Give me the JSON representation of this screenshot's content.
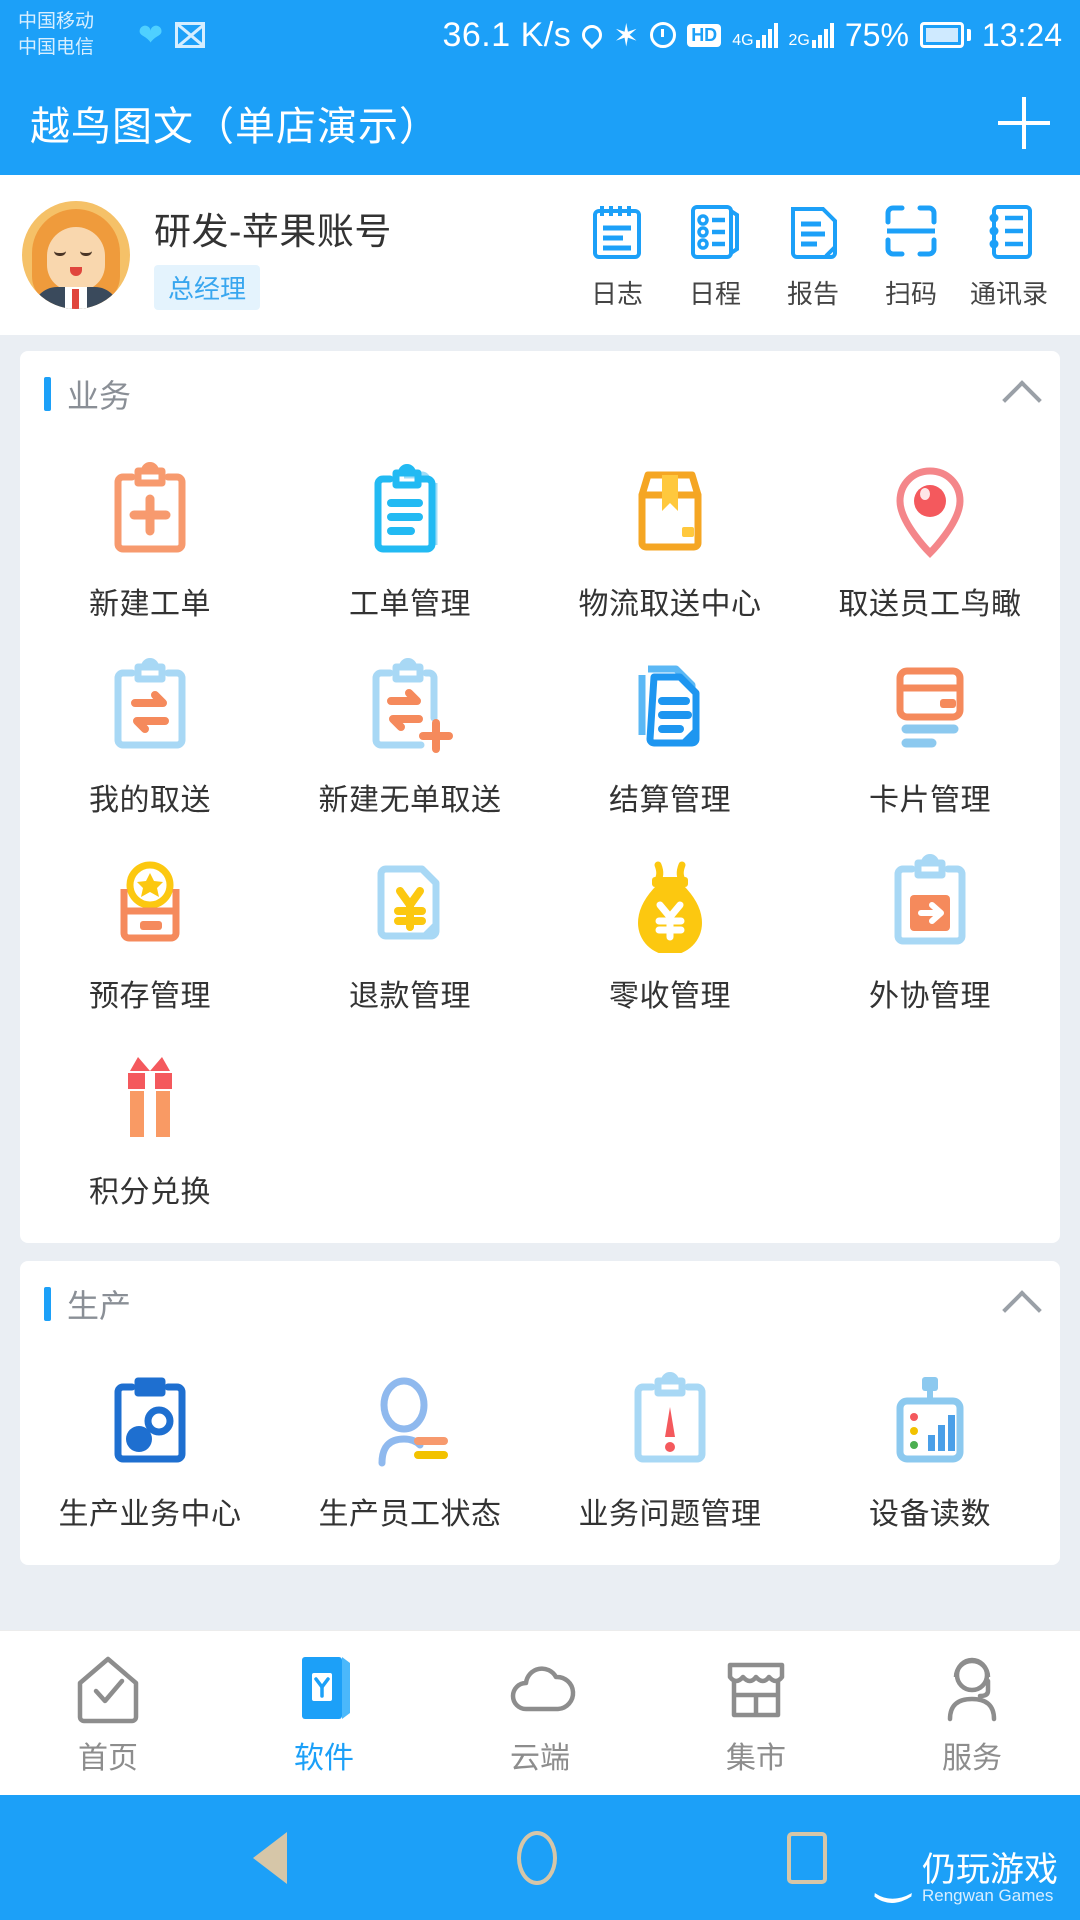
{
  "statusbar": {
    "carrier1": "中国移动",
    "carrier2": "中国电信",
    "net_speed": "36.1 K/s",
    "hd_badge": "HD",
    "sim1_gen": "4G",
    "sim2_gen": "2G",
    "battery_percent": "75%",
    "time": "13:24",
    "icons": [
      "heart-icon",
      "envelope-icon",
      "location-pin-icon",
      "bluetooth-icon",
      "alarm-clock-icon",
      "hd-icon",
      "signal-icon",
      "battery-icon"
    ]
  },
  "appbar": {
    "title": "越鸟图文（单店演示）",
    "add_label": "+"
  },
  "profile": {
    "name": "研发-苹果账号",
    "role_tag": "总经理",
    "quick_actions": [
      {
        "label": "日志",
        "icon": "notepad-icon"
      },
      {
        "label": "日程",
        "icon": "schedule-book-icon"
      },
      {
        "label": "报告",
        "icon": "report-document-icon"
      },
      {
        "label": "扫码",
        "icon": "scan-code-icon"
      },
      {
        "label": "通讯录",
        "icon": "contacts-book-icon"
      }
    ]
  },
  "sections": [
    {
      "title": "业务",
      "collapse_icon": "chevron-up-icon",
      "items": [
        {
          "label": "新建工单",
          "icon": "clipboard-plus-icon",
          "color": "#f79a6e"
        },
        {
          "label": "工单管理",
          "icon": "clipboard-list-icon",
          "color": "#22baf3"
        },
        {
          "label": "物流取送中心",
          "icon": "delivery-box-icon",
          "color": "#f5a623"
        },
        {
          "label": "取送员工鸟瞰",
          "icon": "map-pin-icon",
          "color": "#f4706e"
        },
        {
          "label": "我的取送",
          "icon": "clipboard-exchange-icon",
          "color": "#a8d8f5"
        },
        {
          "label": "新建无单取送",
          "icon": "clipboard-exchange-plus-icon",
          "color": "#a8d8f5"
        },
        {
          "label": "结算管理",
          "icon": "settlement-doc-icon",
          "color": "#1e96f0"
        },
        {
          "label": "卡片管理",
          "icon": "credit-card-icon",
          "color": "#f58a5c"
        },
        {
          "label": "预存管理",
          "icon": "prepaid-card-coin-icon",
          "color": "#f58a5c"
        },
        {
          "label": "退款管理",
          "icon": "refund-yuan-doc-icon",
          "color": "#a8d8f5"
        },
        {
          "label": "零收管理",
          "icon": "money-bag-icon",
          "color": "#fcc810"
        },
        {
          "label": "外协管理",
          "icon": "clipboard-arrow-right-icon",
          "color": "#a8d8f5"
        },
        {
          "label": "积分兑换",
          "icon": "gift-box-icon",
          "color": "#f99a64"
        }
      ]
    },
    {
      "title": "生产",
      "collapse_icon": "chevron-up-icon",
      "items": [
        {
          "label": "生产业务中心",
          "icon": "clipboard-gear-icon",
          "color": "#1e6fd0"
        },
        {
          "label": "生产员工状态",
          "icon": "worker-status-icon",
          "color": "#8fb9ee"
        },
        {
          "label": "业务问题管理",
          "icon": "clipboard-alert-icon",
          "color": "#a8d8f5"
        },
        {
          "label": "设备读数",
          "icon": "device-meter-icon",
          "color": "#a8d8f5"
        }
      ]
    }
  ],
  "tabbar": {
    "active_index": 1,
    "items": [
      {
        "label": "首页",
        "icon": "home-check-icon"
      },
      {
        "label": "软件",
        "icon": "software-app-icon"
      },
      {
        "label": "云端",
        "icon": "cloud-icon"
      },
      {
        "label": "集市",
        "icon": "store-icon"
      },
      {
        "label": "服务",
        "icon": "headset-support-icon"
      }
    ]
  },
  "navbar": {
    "back": "back-triangle-icon",
    "home": "home-circle-icon",
    "recents": "recents-square-icon",
    "watermark_title": "仍玩游戏",
    "watermark_sub": "Rengwan Games"
  },
  "colors": {
    "brand": "#1ca0f8",
    "tag_bg": "#e4f3fd",
    "page_bg": "#eaeef3"
  }
}
